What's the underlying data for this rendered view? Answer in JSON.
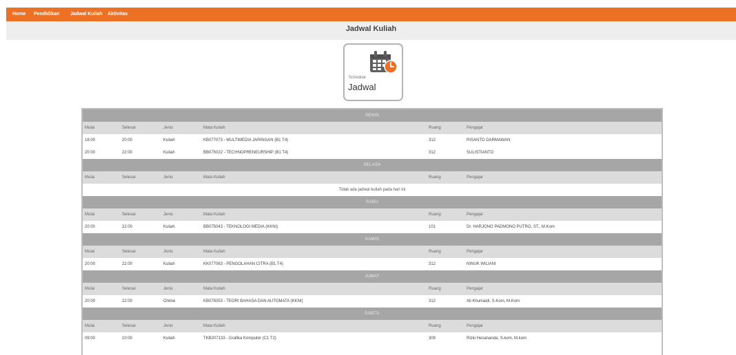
{
  "nav": {
    "items": [
      "Home",
      "Pendidikan",
      "Jadwal Kuliah",
      "Aktivitas"
    ]
  },
  "page_title": "Jadwal Kuliah",
  "card": {
    "small_label": "Schedule",
    "big_label": "Jadwal",
    "icon": "calendar-clock-icon"
  },
  "colors": {
    "accent": "#ec7124",
    "day_header": "#a6a6a6",
    "column_header": "#dcdcdc"
  },
  "columns": [
    "Mulai",
    "Selesai",
    "Jenis",
    "Mata Kuliah",
    "Ruang",
    "Pengajar"
  ],
  "empty_message": "Tidak ada jadwal kuliah pada hari ini",
  "days": [
    {
      "name": "SENIN",
      "rows": [
        [
          "18:00",
          "20:00",
          "Kuliah",
          "KB077073 - MULTIMEDIA JARINGAN (B1 T4)",
          "312",
          "RISANTO DARMAWAN"
        ],
        [
          "20:00",
          "22:00",
          "Kuliah",
          "BB075022 - TECHNOPRENEURSHIP (B1 T4)",
          "312",
          "SULISTIANTO"
        ]
      ]
    },
    {
      "name": "SELASA",
      "rows": []
    },
    {
      "name": "RABU",
      "rows": [
        [
          "20:00",
          "22:00",
          "Kuliah",
          "BB075043 - TEKNOLOGI MEDIA (KKNI)",
          "101",
          "Dr. HARJONO PADMONO PUTRO, ST., M.Kom"
        ]
      ]
    },
    {
      "name": "KAMIS",
      "rows": [
        [
          "20:00",
          "22:00",
          "Kuliah",
          "KK077063 - PENGOLAHAN CITRA (B1 T4)",
          "312",
          "NINUK WILIANI"
        ]
      ]
    },
    {
      "name": "JUMAT",
      "rows": [
        [
          "20:00",
          "22:00",
          "Online",
          "KB075053 - TEORI BAHASA DAN AUTOMATA (KKNI)",
          "312",
          "Ali Khumaidi, S.Kom, M.Kom"
        ]
      ]
    },
    {
      "name": "SABTU",
      "rows": [
        [
          "09:00",
          "10:00",
          "Kuliah",
          "TKB207133 - Grafika Komputer (C1 T2)",
          "309",
          "Rizki Hesananda, S.kom, M.kom"
        ]
      ]
    }
  ]
}
